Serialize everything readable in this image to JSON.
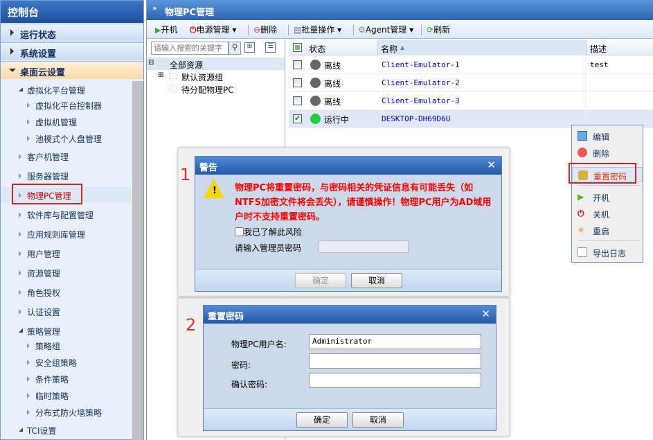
{
  "sidebar": {
    "title": "控制台",
    "sections": [
      {
        "label": "运行状态"
      },
      {
        "label": "系统设置"
      },
      {
        "label": "桌面云设置"
      }
    ],
    "items": [
      {
        "label": "虚拟化平台管理",
        "type": "grp"
      },
      {
        "label": "虚拟化平台控制器",
        "type": "sub"
      },
      {
        "label": "虚拟机管理",
        "type": "sub"
      },
      {
        "label": "池模式个人盘管理",
        "type": "sub"
      },
      {
        "label": "客户机管理"
      },
      {
        "label": "服务器管理"
      },
      {
        "label": "物理PC管理",
        "selected": true
      },
      {
        "label": "软件库与配置管理"
      },
      {
        "label": "应用规则库管理"
      },
      {
        "label": "用户管理"
      },
      {
        "label": "资源管理"
      },
      {
        "label": "角色授权"
      },
      {
        "label": "认证设置"
      },
      {
        "label": "策略管理",
        "type": "grp"
      },
      {
        "label": "策略组",
        "type": "sub"
      },
      {
        "label": "安全组策略",
        "type": "sub"
      },
      {
        "label": "条件策略",
        "type": "sub"
      },
      {
        "label": "临时策略",
        "type": "sub"
      },
      {
        "label": "分布式防火墙策略",
        "type": "sub"
      },
      {
        "label": "TCI设置",
        "type": "grp"
      }
    ]
  },
  "main": {
    "title": "物理PC管理",
    "toolbar": {
      "power_on": "开机",
      "power_mgmt": "电源管理",
      "delete": "删除",
      "batch": "批量操作",
      "agent": "Agent管理",
      "refresh": "刷新"
    },
    "search": {
      "placeholder": "请输入搜索的关键字"
    },
    "tree": {
      "root": "全部资源",
      "children": [
        "默认资源组",
        "待分配物理PC"
      ]
    },
    "grid": {
      "columns": [
        "状态",
        "名称",
        "描述"
      ],
      "sort": "名称 ascending",
      "rows": [
        {
          "status": "离线",
          "name": "Client-Emulator-1",
          "desc": "test",
          "checked": false
        },
        {
          "status": "离线",
          "name": "Client-Emulator-2",
          "desc": "",
          "checked": false
        },
        {
          "status": "离线",
          "name": "Client-Emulator-3",
          "desc": "",
          "checked": false
        },
        {
          "status": "运行中",
          "name": "DESKTOP-DH69D6U",
          "desc": "",
          "checked": true
        }
      ]
    }
  },
  "context_menu": {
    "items": [
      "编辑",
      "删除",
      "重置密码",
      "开机",
      "关机",
      "重启",
      "导出日志"
    ],
    "highlighted": "重置密码"
  },
  "warning_dialog": {
    "step": "1",
    "title": "警告",
    "message": "物理PC将重置密码，与密码相关的凭证信息有可能丢失（如NTFS加密文件将会丢失），请谨慎操作！物理PC用户为AD域用户时不支持重置密码。",
    "ack_label": "我已了解此风险",
    "pwd_label": "请输入管理员密码",
    "ok": "确定",
    "cancel": "取消"
  },
  "reset_dialog": {
    "step": "2",
    "title": "重置密码",
    "user_label": "物理PC用户名:",
    "user_value": "Administrator",
    "pwd_label": "密码:",
    "confirm_label": "确认密码:",
    "ok": "确定",
    "cancel": "取消"
  },
  "colors": {
    "accent": "#2d62b4",
    "warning_text": "#ff0000",
    "highlight_box": "#e02020"
  }
}
